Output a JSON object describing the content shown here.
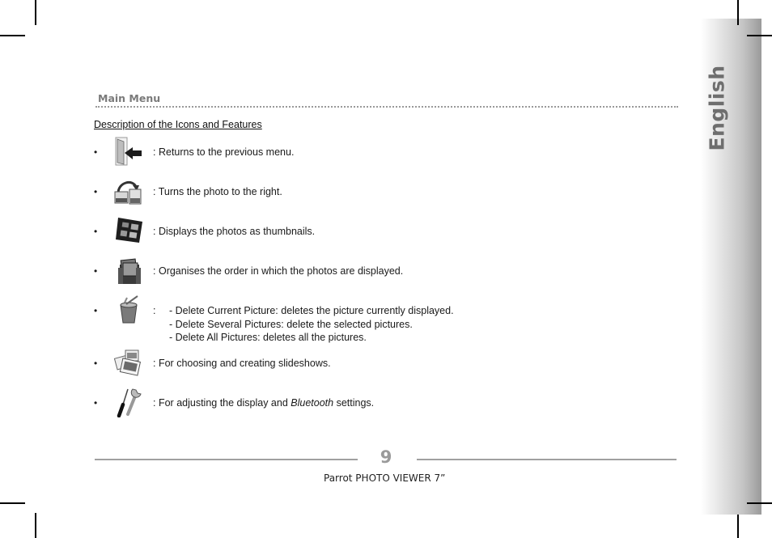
{
  "side_tab": {
    "language": "English"
  },
  "section": {
    "title": "Main Menu",
    "subtitle": "Description of the Icons and Features"
  },
  "items": [
    {
      "icon": "exit-door-icon",
      "bullet": "•",
      "colon": ":",
      "lines": [
        "Returns to the previous menu."
      ]
    },
    {
      "icon": "rotate-photo-icon",
      "bullet": "•",
      "colon": ":",
      "lines": [
        "Turns the photo to the right."
      ]
    },
    {
      "icon": "thumbnails-icon",
      "bullet": "•",
      "colon": ":",
      "lines": [
        "Displays the photos as thumbnails."
      ]
    },
    {
      "icon": "sort-photos-icon",
      "bullet": "•",
      "colon": ":",
      "lines": [
        "Organises the order in which the photos are displayed."
      ]
    },
    {
      "icon": "trash-bin-icon",
      "bullet": "•",
      "colon": ":",
      "lines": [
        "- Delete Current Picture: deletes the picture currently displayed.",
        "- Delete Several Pictures: delete the selected pictures.",
        "- Delete All Pictures: deletes all the pictures."
      ]
    },
    {
      "icon": "slideshow-icon",
      "bullet": "•",
      "colon": ":",
      "lines": [
        "For choosing and creating slideshows."
      ]
    },
    {
      "icon": "settings-tools-icon",
      "bullet": "•",
      "colon": ":",
      "lines_rich": [
        "For adjusting the display and ",
        "Bluetooth",
        " settings."
      ]
    }
  ],
  "footer": {
    "page_number": "9",
    "product": "Parrot PHOTO VIEWER 7”"
  }
}
